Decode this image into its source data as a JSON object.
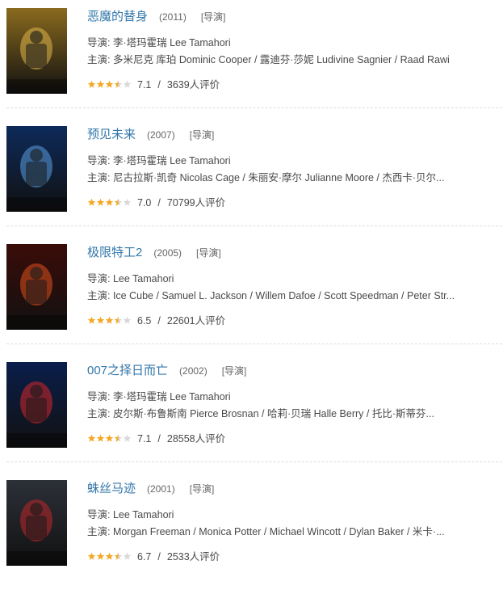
{
  "movies": [
    {
      "title": "恶魔的替身",
      "year": "(2011)",
      "role": "[导演]",
      "director_line": "导演: 李·塔玛霍瑞 Lee Tamahori",
      "cast_line": "主演: 多米尼克 库珀 Dominic Cooper / 露迪芬·莎妮 Ludivine Sagnier / Raad Rawi",
      "rating": "7.1",
      "separator": "/",
      "votes": "3639人评价",
      "stars": 3.5,
      "poster": {
        "name": "devils-double-poster",
        "bg": "#8a6a1e",
        "accent": "#e0b64a"
      }
    },
    {
      "title": "预见未来",
      "year": "(2007)",
      "role": "[导演]",
      "director_line": "导演: 李·塔玛霍瑞 Lee Tamahori",
      "cast_line": "主演: 尼古拉斯·凯奇 Nicolas Cage / 朱丽安·摩尔 Julianne Moore / 杰西卡·贝尔...",
      "rating": "7.0",
      "separator": "/",
      "votes": "70799人评价",
      "stars": 3.5,
      "poster": {
        "name": "next-poster",
        "bg": "#0d2a5a",
        "accent": "#5a9ee0"
      }
    },
    {
      "title": "极限特工2",
      "year": "(2005)",
      "role": "[导演]",
      "director_line": "导演: Lee Tamahori",
      "cast_line": "主演: Ice Cube / Samuel L. Jackson / Willem Dafoe / Scott Speedman / Peter Str...",
      "rating": "6.5",
      "separator": "/",
      "votes": "22601人评价",
      "stars": 3.5,
      "poster": {
        "name": "xxx-state-of-union-poster",
        "bg": "#3a0c08",
        "accent": "#e0501e"
      }
    },
    {
      "title": "007之择日而亡",
      "year": "(2002)",
      "role": "[导演]",
      "director_line": "导演: 李·塔玛霍瑞 Lee Tamahori",
      "cast_line": "主演: 皮尔斯·布鲁斯南 Pierce Brosnan / 哈莉·贝瑞 Halle Berry / 托比·斯蒂芬...",
      "rating": "7.1",
      "separator": "/",
      "votes": "28558人评价",
      "stars": 3.5,
      "poster": {
        "name": "die-another-day-poster",
        "bg": "#0a1e4a",
        "accent": "#d8262a"
      }
    },
    {
      "title": "蛛丝马迹",
      "year": "(2001)",
      "role": "[导演]",
      "director_line": "导演: Lee Tamahori",
      "cast_line": "主演: Morgan Freeman / Monica Potter / Michael Wincott / Dylan Baker / 米卡·...",
      "rating": "6.7",
      "separator": "/",
      "votes": "2533人评价",
      "stars": 3.5,
      "poster": {
        "name": "along-came-a-spider-poster",
        "bg": "#2c3038",
        "accent": "#c0262a"
      }
    }
  ],
  "colors": {
    "star_on": "#f5a623",
    "star_off": "#d8d8d8",
    "title": "#3377aa"
  }
}
